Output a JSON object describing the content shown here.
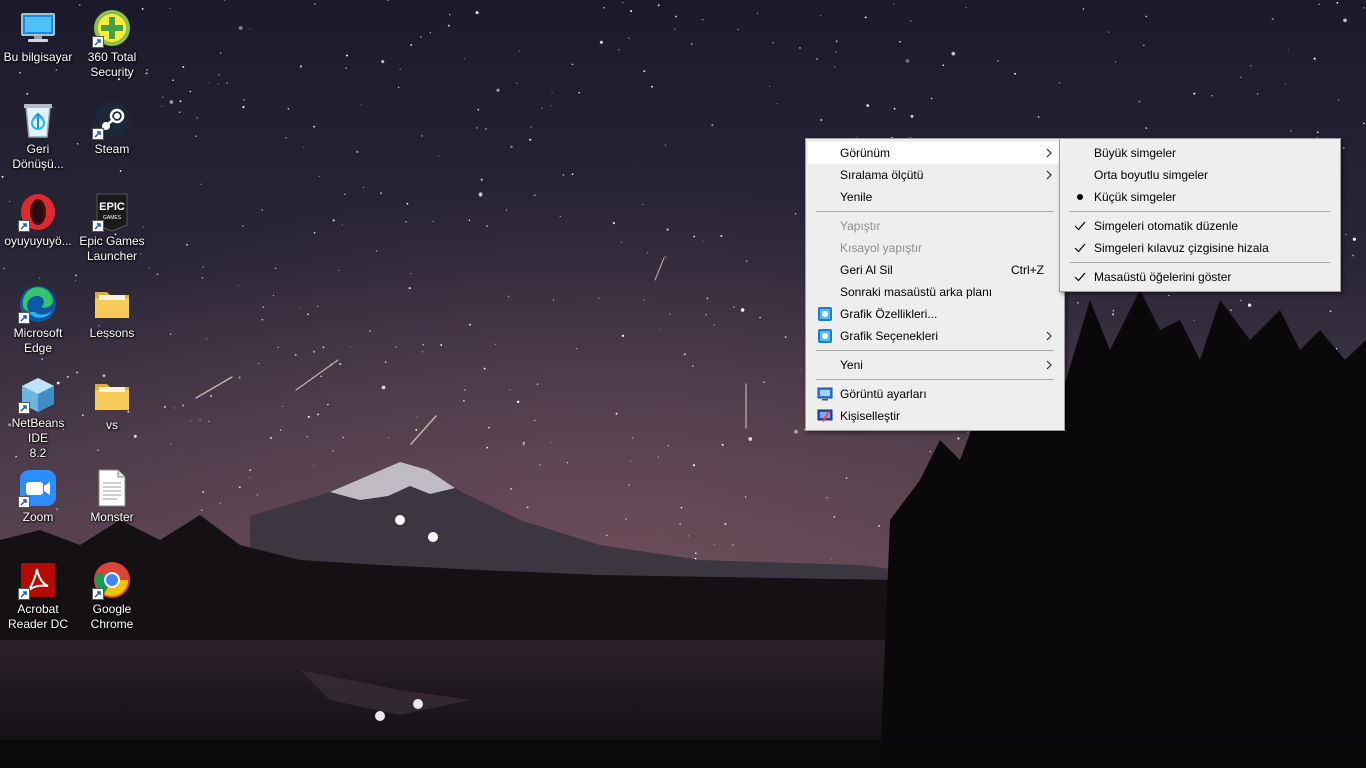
{
  "desktop": {
    "icons": [
      {
        "label": "Bu bilgisayar",
        "icon": "this-pc-icon",
        "shortcut": false
      },
      {
        "label": "360 Total\nSecurity",
        "icon": "360-total-security-icon",
        "shortcut": true
      },
      {
        "label": "Geri\nDönüşü...",
        "icon": "recycle-bin-icon",
        "shortcut": false
      },
      {
        "label": "Steam",
        "icon": "steam-icon",
        "shortcut": true
      },
      {
        "label": "oyuyuyuyö...",
        "icon": "opera-icon",
        "shortcut": true
      },
      {
        "label": "Epic Games\nLauncher",
        "icon": "epic-games-icon",
        "shortcut": true
      },
      {
        "label": "Microsoft\nEdge",
        "icon": "edge-icon",
        "shortcut": true
      },
      {
        "label": "Lessons",
        "icon": "folder-icon",
        "shortcut": false
      },
      {
        "label": "NetBeans IDE\n8.2",
        "icon": "netbeans-icon",
        "shortcut": true
      },
      {
        "label": "vs",
        "icon": "folder-icon",
        "shortcut": false
      },
      {
        "label": "Zoom",
        "icon": "zoom-icon",
        "shortcut": true
      },
      {
        "label": "Monster",
        "icon": "text-file-icon",
        "shortcut": false
      },
      {
        "label": "Acrobat\nReader DC",
        "icon": "acrobat-icon",
        "shortcut": true
      },
      {
        "label": "Google\nChrome",
        "icon": "chrome-icon",
        "shortcut": true
      }
    ],
    "epic_logo_text": "EPIC",
    "epic_logo_subtext": "GAMES"
  },
  "context_menu": {
    "items": {
      "view": "Görünüm",
      "sort_by": "Sıralama ölçütü",
      "refresh": "Yenile",
      "paste": "Yapıştır",
      "paste_shortcut": "Kısayol yapıştır",
      "undo_delete": "Geri Al Sil",
      "undo_delete_key": "Ctrl+Z",
      "next_background": "Sonraki masaüstü arka planı",
      "graphics_properties": "Grafik Özellikleri...",
      "graphics_options": "Grafik Seçenekleri",
      "new": "Yeni",
      "display_settings": "Görüntü ayarları",
      "personalize": "Kişiselleştir"
    }
  },
  "view_submenu": {
    "items": {
      "large_icons": "Büyük simgeler",
      "medium_icons": "Orta boyutlu simgeler",
      "small_icons": "Küçük simgeler",
      "auto_arrange": "Simgeleri otomatik düzenle",
      "align_to_grid": "Simgeleri kılavuz çizgisine hizala",
      "show_desktop_icons": "Masaüstü öğelerini göster"
    },
    "selected_size": "small_icons",
    "checked": [
      "auto_arrange",
      "align_to_grid",
      "show_desktop_icons"
    ]
  },
  "colors": {
    "menu_bg": "#eeeeee",
    "menu_hover": "#ffffff",
    "disabled_text": "#8e8e8e"
  }
}
